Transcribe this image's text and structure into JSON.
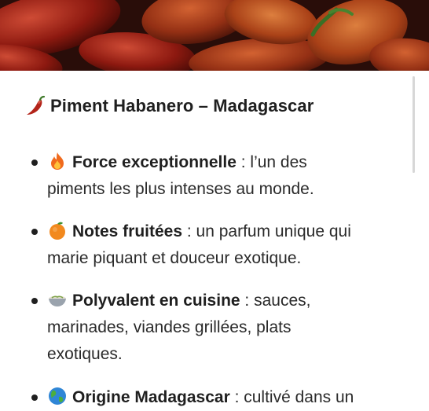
{
  "header": {
    "title": "Piment Habanero – Madagascar",
    "title_icon": "chili-pepper-icon"
  },
  "features": [
    {
      "icon": "fire-icon",
      "label": "Force exceptionnelle",
      "text_line1": " : l’un des",
      "text_line2": "piments les plus intenses au monde."
    },
    {
      "icon": "orange-icon",
      "label": "Notes fruitées",
      "text_line1": " : un parfum unique qui",
      "text_line2": "marie piquant et douceur exotique."
    },
    {
      "icon": "bowl-icon",
      "label": "Polyvalent en cuisine",
      "text_line1": " : sauces,",
      "text_line2": "marinades, viandes grillées, plats",
      "text_line3": "exotiques."
    },
    {
      "icon": "globe-icon",
      "label": "Origine Madagascar",
      "text_line1": " : cultivé dans un"
    }
  ],
  "colors": {
    "text": "#1f1f1f",
    "pepper_red": "#b3241a",
    "hero_dark": "#2a0d08"
  }
}
